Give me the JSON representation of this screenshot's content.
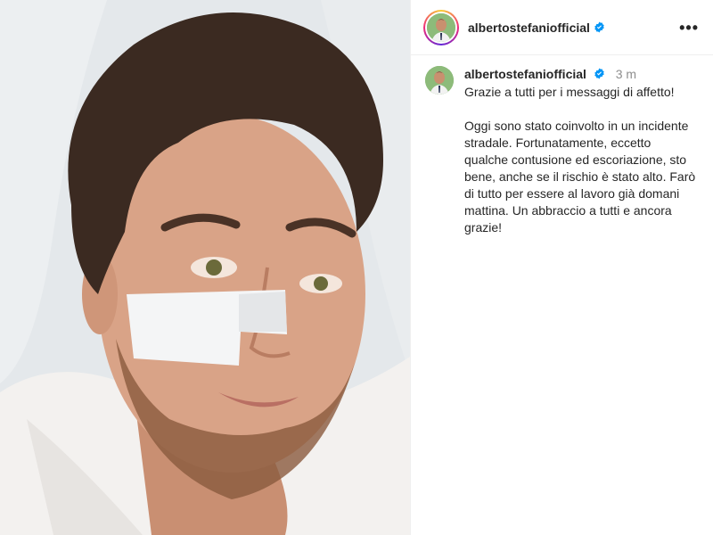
{
  "post": {
    "photo": {
      "alt_subject": "selfie-in-hospital-bed",
      "colors": {
        "pillow": "#e6e9ec",
        "skin": "#d9a387",
        "hair": "#3b2a21",
        "bandage": "#f4f5f6"
      }
    },
    "header": {
      "username": "albertostefaniofficial",
      "verified_icon": "verified-badge-icon",
      "more_icon": "more-options-icon",
      "more_label": "•••"
    },
    "caption": {
      "username": "albertostefaniofficial",
      "time": "3 m",
      "text": "Grazie a tutti per i messaggi di affetto!\n\nOggi sono stato coinvolto in un incidente stradale. Fortunatamente, eccetto qualche contusione ed escoriazione, sto bene, anche se il rischio è stato alto. Farò di tutto per essere al lavoro già domani mattina. Un abbraccio a tutti e ancora grazie!"
    },
    "colors": {
      "verified": "#0095f6",
      "text": "#262626",
      "muted": "#8e8e8e",
      "divider": "#efefef"
    }
  }
}
